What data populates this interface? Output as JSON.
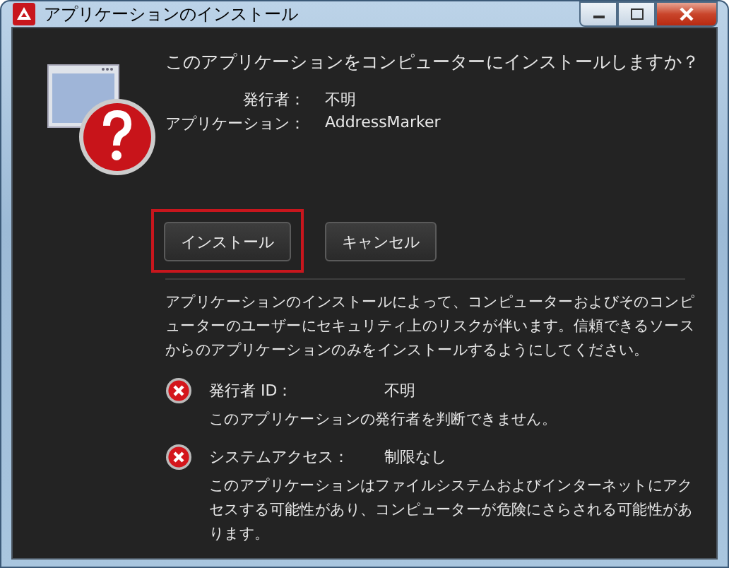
{
  "window": {
    "title": "アプリケーションのインストール"
  },
  "question": "このアプリケーションをコンピューターにインストールしますか？",
  "details": [
    {
      "label": "発行者：",
      "value": "不明"
    },
    {
      "label": "アプリケーション：",
      "value": "AddressMarker"
    }
  ],
  "buttons": [
    {
      "label": "インストール",
      "focused": true
    },
    {
      "label": "キャンセル",
      "focused": false
    }
  ],
  "warning": "アプリケーションのインストールによって、コンピューターおよびそのコンピューターのユーザーにセキュリティ上のリスクが伴います。信頼できるソースからのアプリケーションのみをインストールするようにしてください。",
  "risks": [
    {
      "label": "発行者 ID：",
      "value": "不明",
      "description": "このアプリケーションの発行者を判断できません。"
    },
    {
      "label": "システムアクセス：",
      "value": "制限なし",
      "description": "このアプリケーションはファイルシステムおよびインターネットにアクセスする可能性があり、コンピューターが危険にさらされる可能性があります。"
    }
  ]
}
